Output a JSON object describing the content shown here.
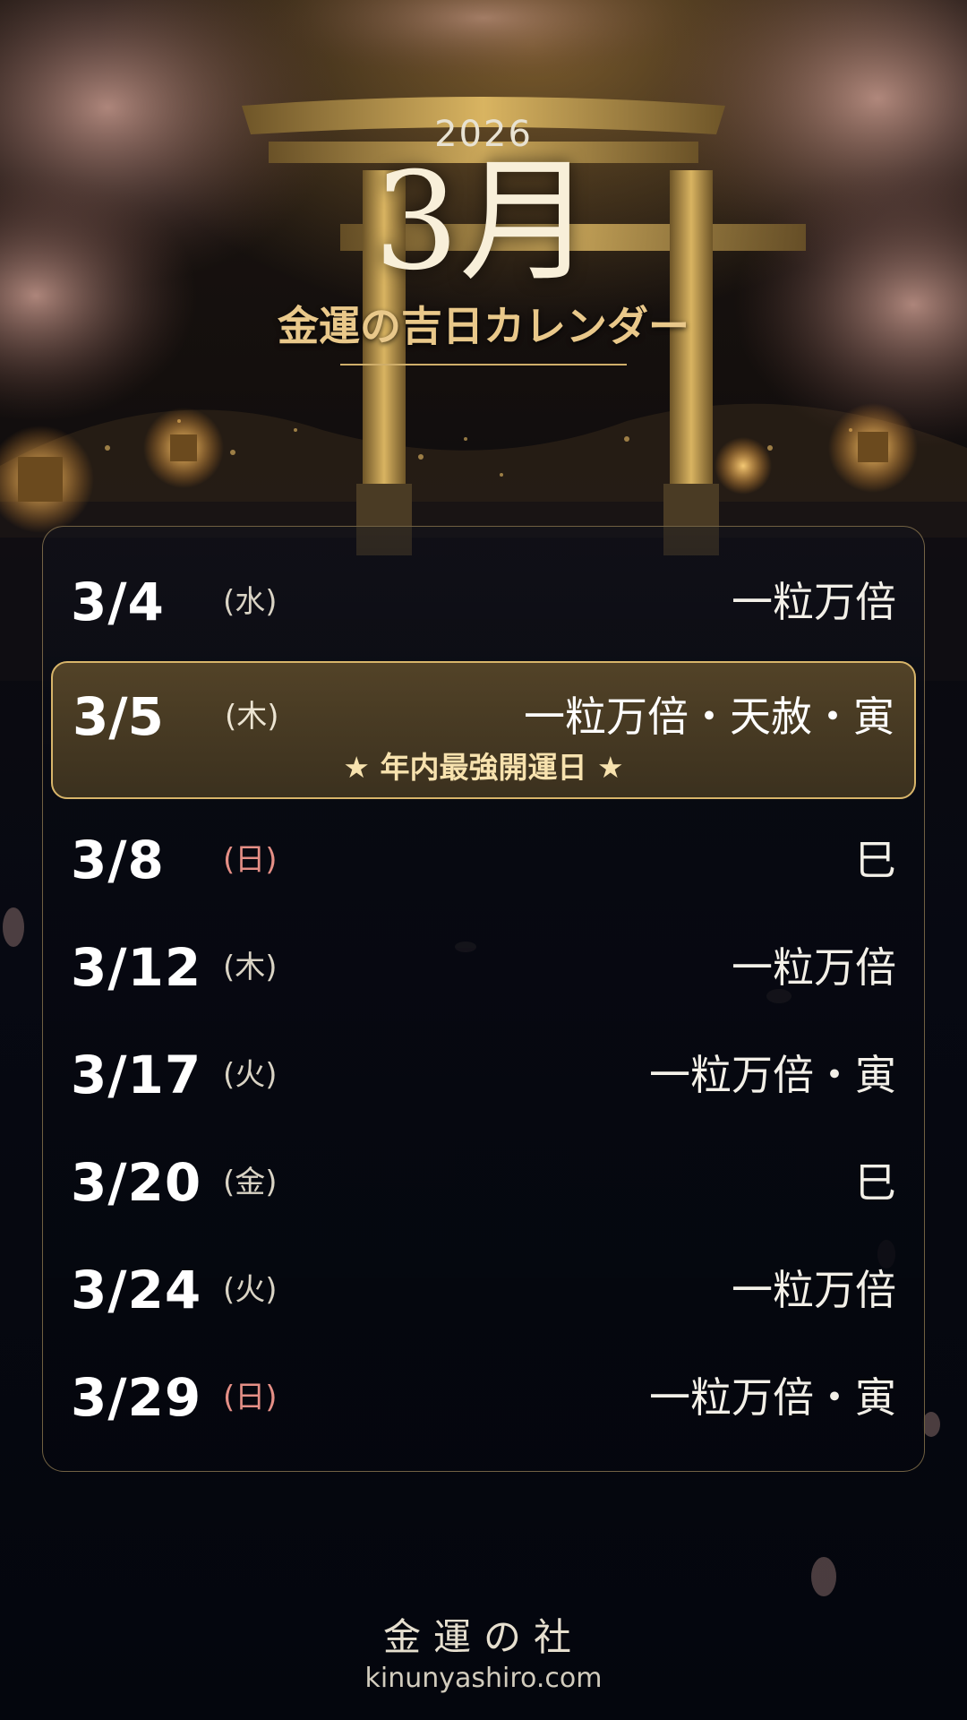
{
  "header": {
    "year": "2026",
    "month": "3月",
    "subtitle": "金運の吉日カレンダー"
  },
  "colors": {
    "gold_accent": "#d8b56a",
    "sunday_red": "#e58f86",
    "background": "#04060d"
  },
  "calendar": {
    "days": [
      {
        "date": "3/4",
        "weekday": "(水)",
        "label": "一粒万倍",
        "weekday_type": "weekday"
      },
      {
        "date": "3/5",
        "weekday": "(木)",
        "label": "一粒万倍・天赦・寅",
        "weekday_type": "weekday",
        "highlighted": true,
        "note": "★ 年内最強開運日 ★"
      },
      {
        "date": "3/8",
        "weekday": "(日)",
        "label": "巳",
        "weekday_type": "sunday"
      },
      {
        "date": "3/12",
        "weekday": "(木)",
        "label": "一粒万倍",
        "weekday_type": "weekday"
      },
      {
        "date": "3/17",
        "weekday": "(火)",
        "label": "一粒万倍・寅",
        "weekday_type": "weekday"
      },
      {
        "date": "3/20",
        "weekday": "(金)",
        "label": "巳",
        "weekday_type": "weekday"
      },
      {
        "date": "3/24",
        "weekday": "(火)",
        "label": "一粒万倍",
        "weekday_type": "weekday"
      },
      {
        "date": "3/29",
        "weekday": "(日)",
        "label": "一粒万倍・寅",
        "weekday_type": "sunday"
      }
    ]
  },
  "footer": {
    "name": "金運の社",
    "url": "kinunyashiro.com"
  }
}
